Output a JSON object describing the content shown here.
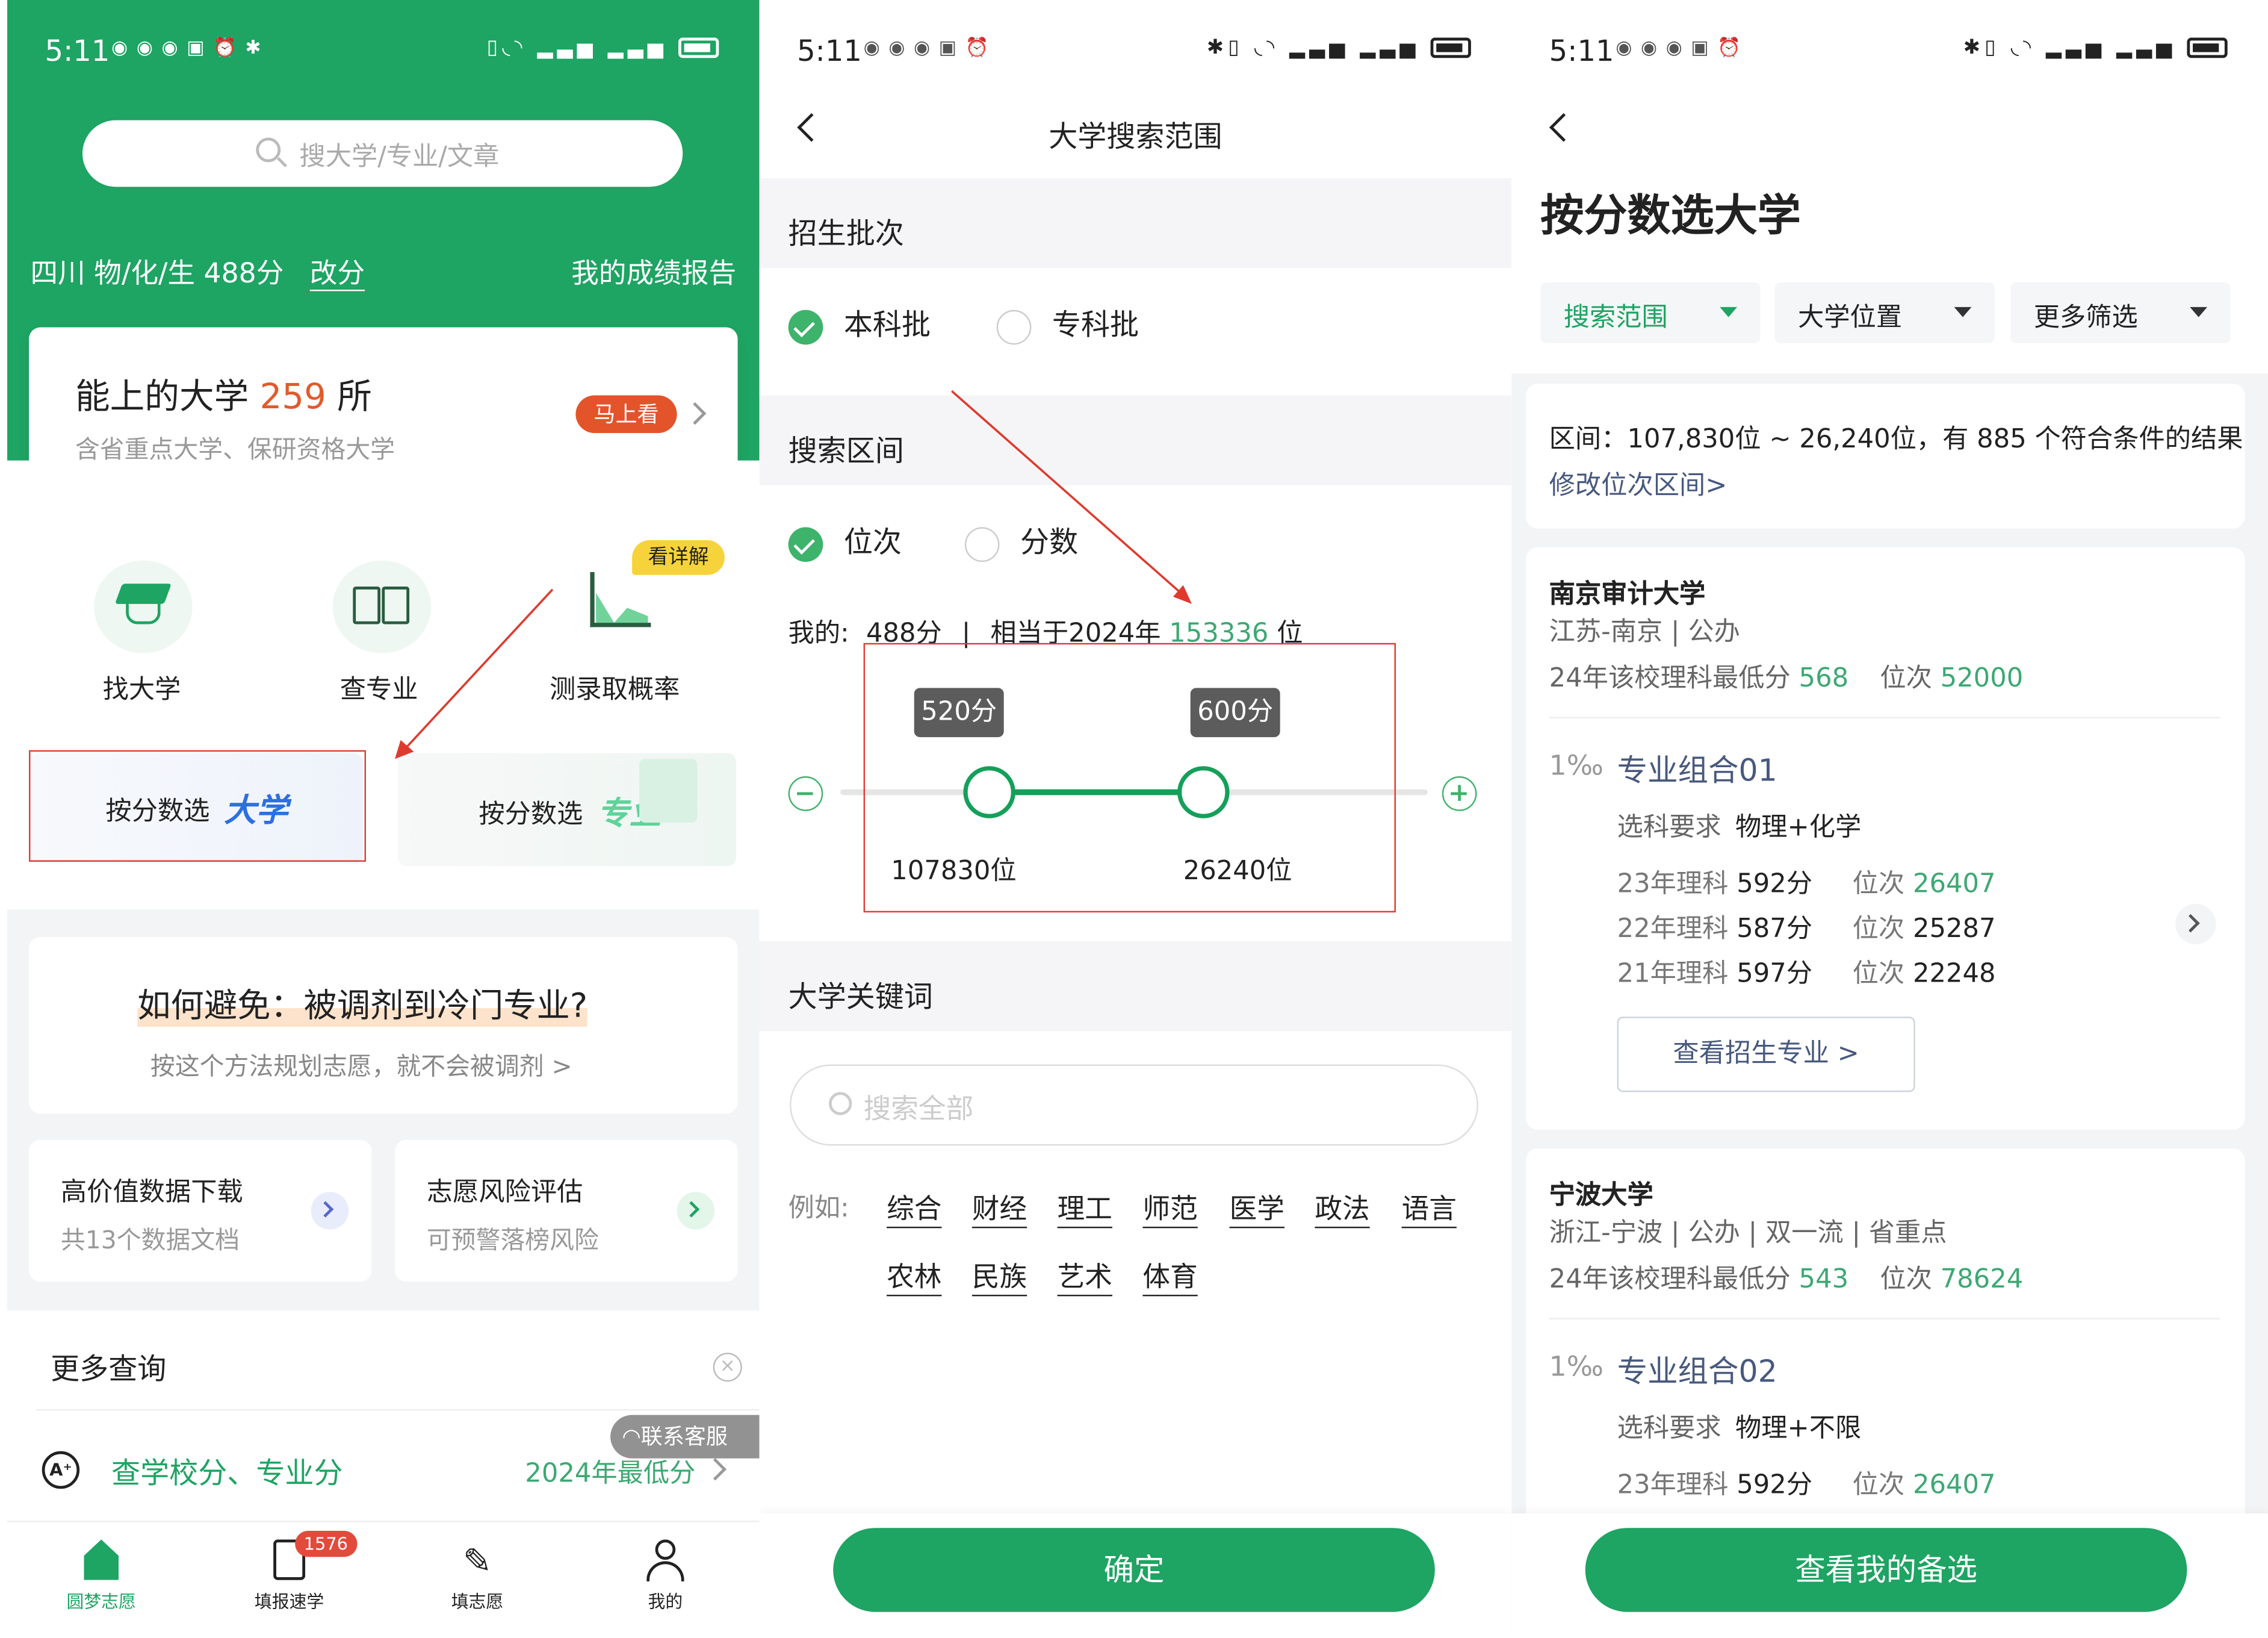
{
  "status": {
    "time": "5:11"
  },
  "p1": {
    "search_placeholder": "搜大学/专业/文章",
    "score_line": "四川 物/化/生 488分",
    "change_score": "改分",
    "report_link": "我的成绩报告",
    "card": {
      "prefix": "能上的大学",
      "count": "259",
      "suffix": "所",
      "sub": "含省重点大学、保研资格大学",
      "btn": "马上看"
    },
    "quick": [
      {
        "label": "找大学",
        "icon": "graduation-cap-icon"
      },
      {
        "label": "查专业",
        "icon": "book-icon"
      },
      {
        "label": "测录取概率",
        "icon": "area-chart-icon"
      }
    ],
    "detail_badge": "看详解",
    "tile_uni": {
      "label": "按分数选",
      "accent": "大学"
    },
    "tile_major": {
      "label": "按分数选",
      "accent": "专业"
    },
    "avoid": {
      "title": "如何避免：被调剂到冷门专业?",
      "sub": "按这个方法规划志愿，就不会被调剂 >"
    },
    "mini1": {
      "title": "高价值数据下载",
      "sub": "共13个数据文档"
    },
    "mini2": {
      "title": "志愿风险评估",
      "sub": "可预警落榜风险"
    },
    "more_query": "更多查询",
    "query_link": "查学校分、专业分",
    "query_right": "2024年最低分",
    "contact": "联系客服",
    "tabs": [
      {
        "label": "圆梦志愿",
        "icon": "home-icon",
        "active": true
      },
      {
        "label": "填报速学",
        "icon": "document-icon",
        "badge": "1576"
      },
      {
        "label": "填志愿",
        "icon": "pen-icon"
      },
      {
        "label": "我的",
        "icon": "user-icon"
      }
    ]
  },
  "p2": {
    "title": "大学搜索范围",
    "batch_section": "招生批次",
    "batch_options": [
      "本科批",
      "专科批"
    ],
    "range_section": "搜索区间",
    "range_options": [
      "位次",
      "分数"
    ],
    "mine_prefix": "我的:",
    "mine_score": "488分",
    "mine_sep": "|",
    "mine_equiv": "相当于2024年",
    "mine_rank": "153336",
    "mine_unit": "位",
    "slider": {
      "low_score": "520分",
      "high_score": "600分",
      "low_rank": "107830位",
      "high_rank": "26240位"
    },
    "keyword_section": "大学关键词",
    "keyword_placeholder": "搜索全部",
    "example_label": "例如:",
    "keywords": [
      "综合",
      "财经",
      "理工",
      "师范",
      "医学",
      "政法",
      "语言",
      "农林",
      "民族",
      "艺术",
      "体育"
    ],
    "confirm": "确定"
  },
  "p3": {
    "page_title": "按分数选大学",
    "filters": [
      "搜索范围",
      "大学位置",
      "更多筛选"
    ],
    "summary": "区间：107,830位 ~ 26,240位，有 885 个符合条件的结果",
    "modify": "修改位次区间>",
    "unis": [
      {
        "name": "南京审计大学",
        "meta": "江苏-南京 | 公办",
        "min_label": "24年该校理科最低分",
        "min_score": "568",
        "rank_label": "位次",
        "rank": "52000",
        "prob": "1‰",
        "group": "专业组合01",
        "req_label": "选科要求",
        "req": "物理+化学",
        "history": [
          {
            "label": "23年理科",
            "score": "592分",
            "rank_label": "位次",
            "rank": "26407"
          },
          {
            "label": "22年理科",
            "score": "587分",
            "rank_label": "位次",
            "rank": "25287"
          },
          {
            "label": "21年理科",
            "score": "597分",
            "rank_label": "位次",
            "rank": "22248"
          }
        ],
        "view_btn": "查看招生专业 >"
      },
      {
        "name": "宁波大学",
        "meta": "浙江-宁波 | 公办 | 双一流 | 省重点",
        "min_label": "24年该校理科最低分",
        "min_score": "543",
        "rank_label": "位次",
        "rank": "78624",
        "prob": "1‰",
        "group": "专业组合02",
        "req_label": "选科要求",
        "req": "物理+不限",
        "history": [
          {
            "label": "23年理科",
            "score": "592分",
            "rank_label": "位次",
            "rank": "26407"
          }
        ]
      }
    ],
    "bottom_btn": "查看我的备选"
  },
  "colors": {
    "brand_green": "#1ea463",
    "accent_orange": "#e25a2c",
    "slider_green": "#14a05a",
    "annotation_red": "#e03a2f",
    "link_blue": "#48597e"
  }
}
